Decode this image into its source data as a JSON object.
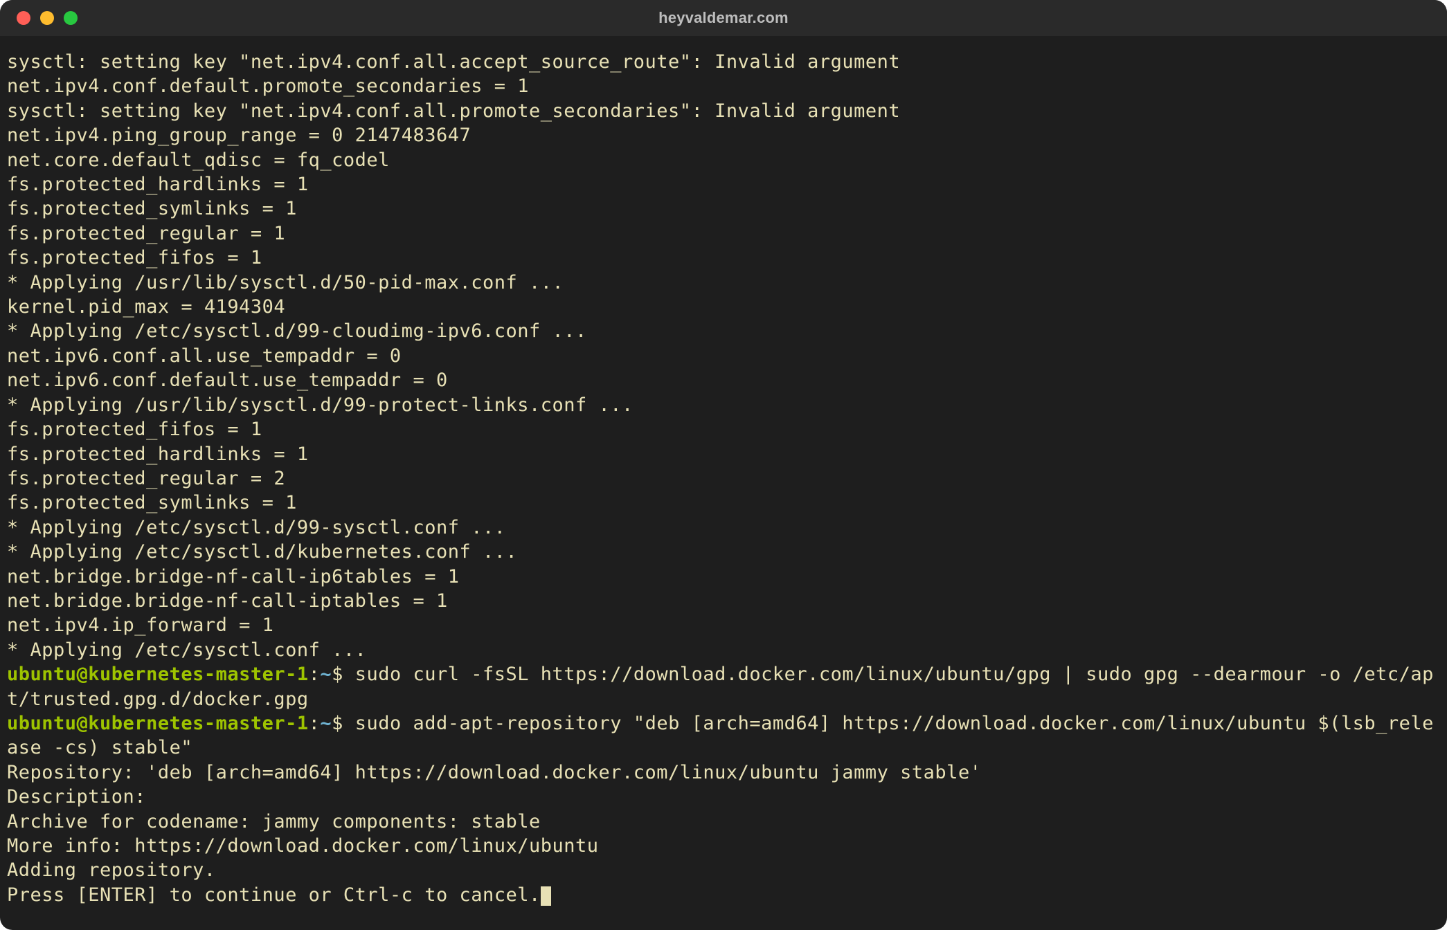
{
  "window": {
    "title": "heyvaldemar.com",
    "traffic_lights": [
      "close",
      "minimize",
      "zoom"
    ]
  },
  "prompt": {
    "user_host": "ubuntu@kubernetes-master-1",
    "separator": ":",
    "path": "~",
    "symbol": "$"
  },
  "colors": {
    "bg": "#1e1e1e",
    "titlebar": "#2a2a2a",
    "text": "#e8e1b5",
    "prompt_user": "#9ec400",
    "prompt_path": "#6fb3d2"
  },
  "output_lines": [
    "sysctl: setting key \"net.ipv4.conf.all.accept_source_route\": Invalid argument",
    "net.ipv4.conf.default.promote_secondaries = 1",
    "sysctl: setting key \"net.ipv4.conf.all.promote_secondaries\": Invalid argument",
    "net.ipv4.ping_group_range = 0 2147483647",
    "net.core.default_qdisc = fq_codel",
    "fs.protected_hardlinks = 1",
    "fs.protected_symlinks = 1",
    "fs.protected_regular = 1",
    "fs.protected_fifos = 1",
    "* Applying /usr/lib/sysctl.d/50-pid-max.conf ...",
    "kernel.pid_max = 4194304",
    "* Applying /etc/sysctl.d/99-cloudimg-ipv6.conf ...",
    "net.ipv6.conf.all.use_tempaddr = 0",
    "net.ipv6.conf.default.use_tempaddr = 0",
    "* Applying /usr/lib/sysctl.d/99-protect-links.conf ...",
    "fs.protected_fifos = 1",
    "fs.protected_hardlinks = 1",
    "fs.protected_regular = 2",
    "fs.protected_symlinks = 1",
    "* Applying /etc/sysctl.d/99-sysctl.conf ...",
    "* Applying /etc/sysctl.d/kubernetes.conf ...",
    "net.bridge.bridge-nf-call-ip6tables = 1",
    "net.bridge.bridge-nf-call-iptables = 1",
    "net.ipv4.ip_forward = 1",
    "* Applying /etc/sysctl.conf ..."
  ],
  "commands": [
    "sudo curl -fsSL https://download.docker.com/linux/ubuntu/gpg | sudo gpg --dearmour -o /etc/apt/trusted.gpg.d/docker.gpg",
    "sudo add-apt-repository \"deb [arch=amd64] https://download.docker.com/linux/ubuntu $(lsb_release -cs) stable\""
  ],
  "post_output_lines": [
    "Repository: 'deb [arch=amd64] https://download.docker.com/linux/ubuntu jammy stable'",
    "Description:",
    "Archive for codename: jammy components: stable",
    "More info: https://download.docker.com/linux/ubuntu",
    "Adding repository.",
    "Press [ENTER] to continue or Ctrl-c to cancel."
  ]
}
